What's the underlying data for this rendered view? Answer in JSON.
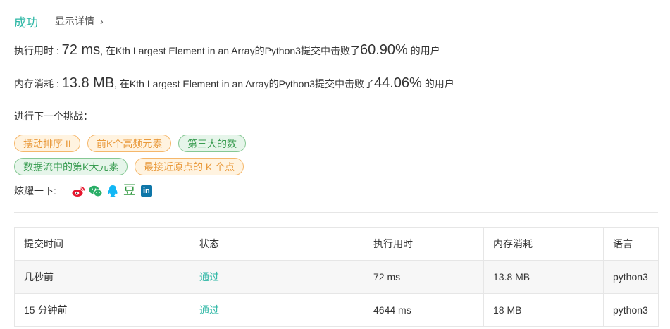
{
  "result": {
    "status": "成功",
    "details_label": "显示详情",
    "details_chevron": "›"
  },
  "runtime": {
    "label": "执行用时 : ",
    "value": "72 ms",
    "text": ", 在Kth Largest Element in an Array的Python3提交中击败了",
    "percent": "60.90%",
    "suffix": " 的用户"
  },
  "memory": {
    "label": "内存消耗 : ",
    "value": "13.8 MB",
    "text": ", 在Kth Largest Element in an Array的Python3提交中击败了",
    "percent": "44.06%",
    "suffix": " 的用户"
  },
  "next": {
    "label": "进行下一个挑战：",
    "tags": [
      {
        "label": "摆动排序 II",
        "color": "orange"
      },
      {
        "label": "前K个高频元素",
        "color": "orange"
      },
      {
        "label": "第三大的数",
        "color": "green"
      },
      {
        "label": "数据流中的第K大元素",
        "color": "green"
      },
      {
        "label": "最接近原点的 K 个点",
        "color": "orange"
      }
    ]
  },
  "share": {
    "label": "炫耀一下:",
    "icons": [
      "weibo-icon",
      "wechat-icon",
      "qq-icon",
      "douban-icon",
      "linkedin-icon"
    ],
    "douban_glyph": "豆",
    "linkedin_glyph": "in"
  },
  "colors": {
    "accent": "#2db7a5",
    "orange_tag_bg": "#fff3e0",
    "orange_tag_text": "#e99a3c",
    "green_tag_bg": "#e6f5ea",
    "green_tag_text": "#3a9d52"
  },
  "table": {
    "headers": [
      "提交时间",
      "状态",
      "执行用时",
      "内存消耗",
      "语言"
    ],
    "rows": [
      [
        "几秒前",
        "通过",
        "72 ms",
        "13.8 MB",
        "python3"
      ],
      [
        "15 分钟前",
        "通过",
        "4644 ms",
        "18 MB",
        "python3"
      ]
    ]
  }
}
